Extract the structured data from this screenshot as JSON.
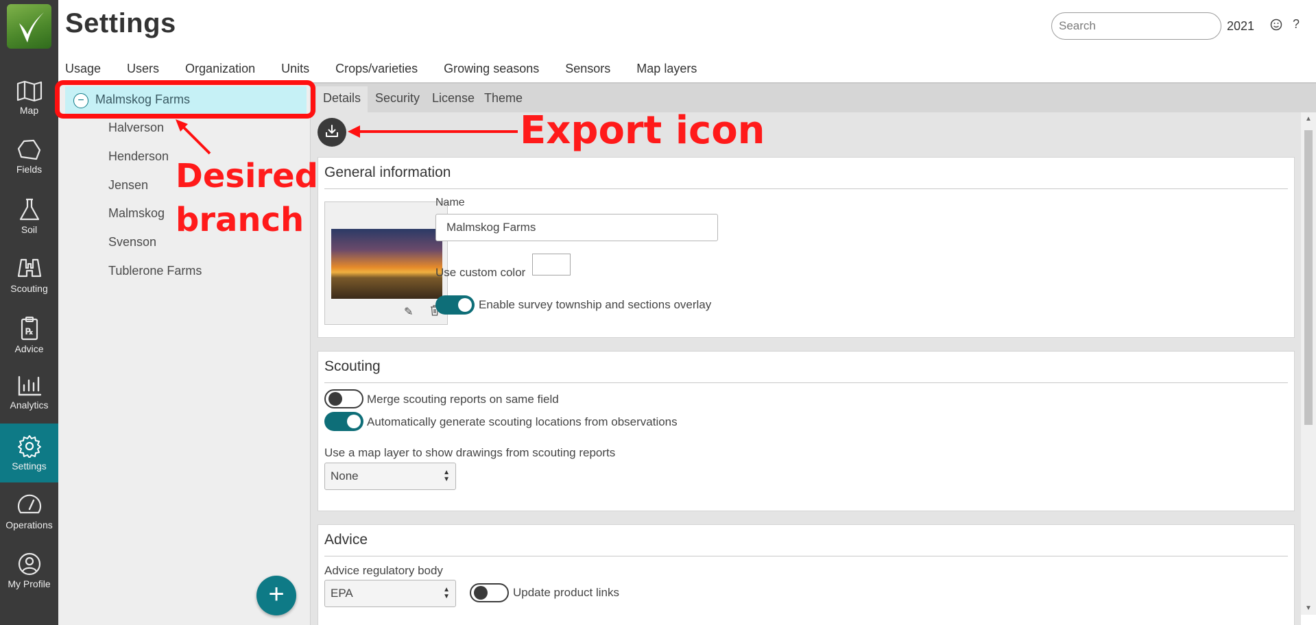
{
  "app": {
    "page_title": "Settings",
    "search_placeholder": "Search",
    "year": "2021",
    "help_glyph": "?"
  },
  "rail": {
    "items": [
      {
        "label": "Map",
        "icon": "map-icon"
      },
      {
        "label": "Fields",
        "icon": "fields-icon"
      },
      {
        "label": "Soil",
        "icon": "flask-icon"
      },
      {
        "label": "Scouting",
        "icon": "binoculars-icon"
      },
      {
        "label": "Advice",
        "icon": "prescription-icon"
      },
      {
        "label": "Analytics",
        "icon": "bar-chart-icon"
      },
      {
        "label": "Settings",
        "icon": "gear-icon",
        "active": true
      },
      {
        "label": "Operations",
        "icon": "gauge-icon"
      },
      {
        "label": "My Profile",
        "icon": "user-icon"
      }
    ]
  },
  "topnav": [
    "Usage",
    "Users",
    "Organization",
    "Units",
    "Crops/varieties",
    "Growing seasons",
    "Sensors",
    "Map layers"
  ],
  "tree": {
    "toggle_glyph": "−",
    "root": "Malmskog Farms",
    "children": [
      "Halverson",
      "Henderson",
      "Jensen",
      "Malmskog",
      "Svenson",
      "Tublerone Farms"
    ],
    "add_glyph": "+"
  },
  "subtabs": [
    "Details",
    "Security",
    "License",
    "Theme"
  ],
  "general": {
    "title": "General information",
    "name_label": "Name",
    "name_value": "Malmskog Farms",
    "custom_color_label": "Use custom color",
    "survey_toggle_label": "Enable survey township and sections overlay",
    "survey_toggle_on": true
  },
  "scouting": {
    "title": "Scouting",
    "merge_label": "Merge scouting reports on same field",
    "merge_on": false,
    "auto_label": "Automatically generate scouting locations from observations",
    "auto_on": true,
    "map_layer_label": "Use a map layer to show drawings from scouting reports",
    "map_layer_value": "None"
  },
  "advice": {
    "title": "Advice",
    "regulatory_label": "Advice regulatory body",
    "regulatory_value": "EPA",
    "product_links_label": "Update product links",
    "product_links_on": false
  },
  "annotations": {
    "export_label": "Export icon",
    "branch_line1": "Desired",
    "branch_line2": "branch",
    "color": "#ff1a1a"
  },
  "colors": {
    "accent": "#0e7a86",
    "rail": "#3a3a3a",
    "selection": "#c6f1f6"
  }
}
